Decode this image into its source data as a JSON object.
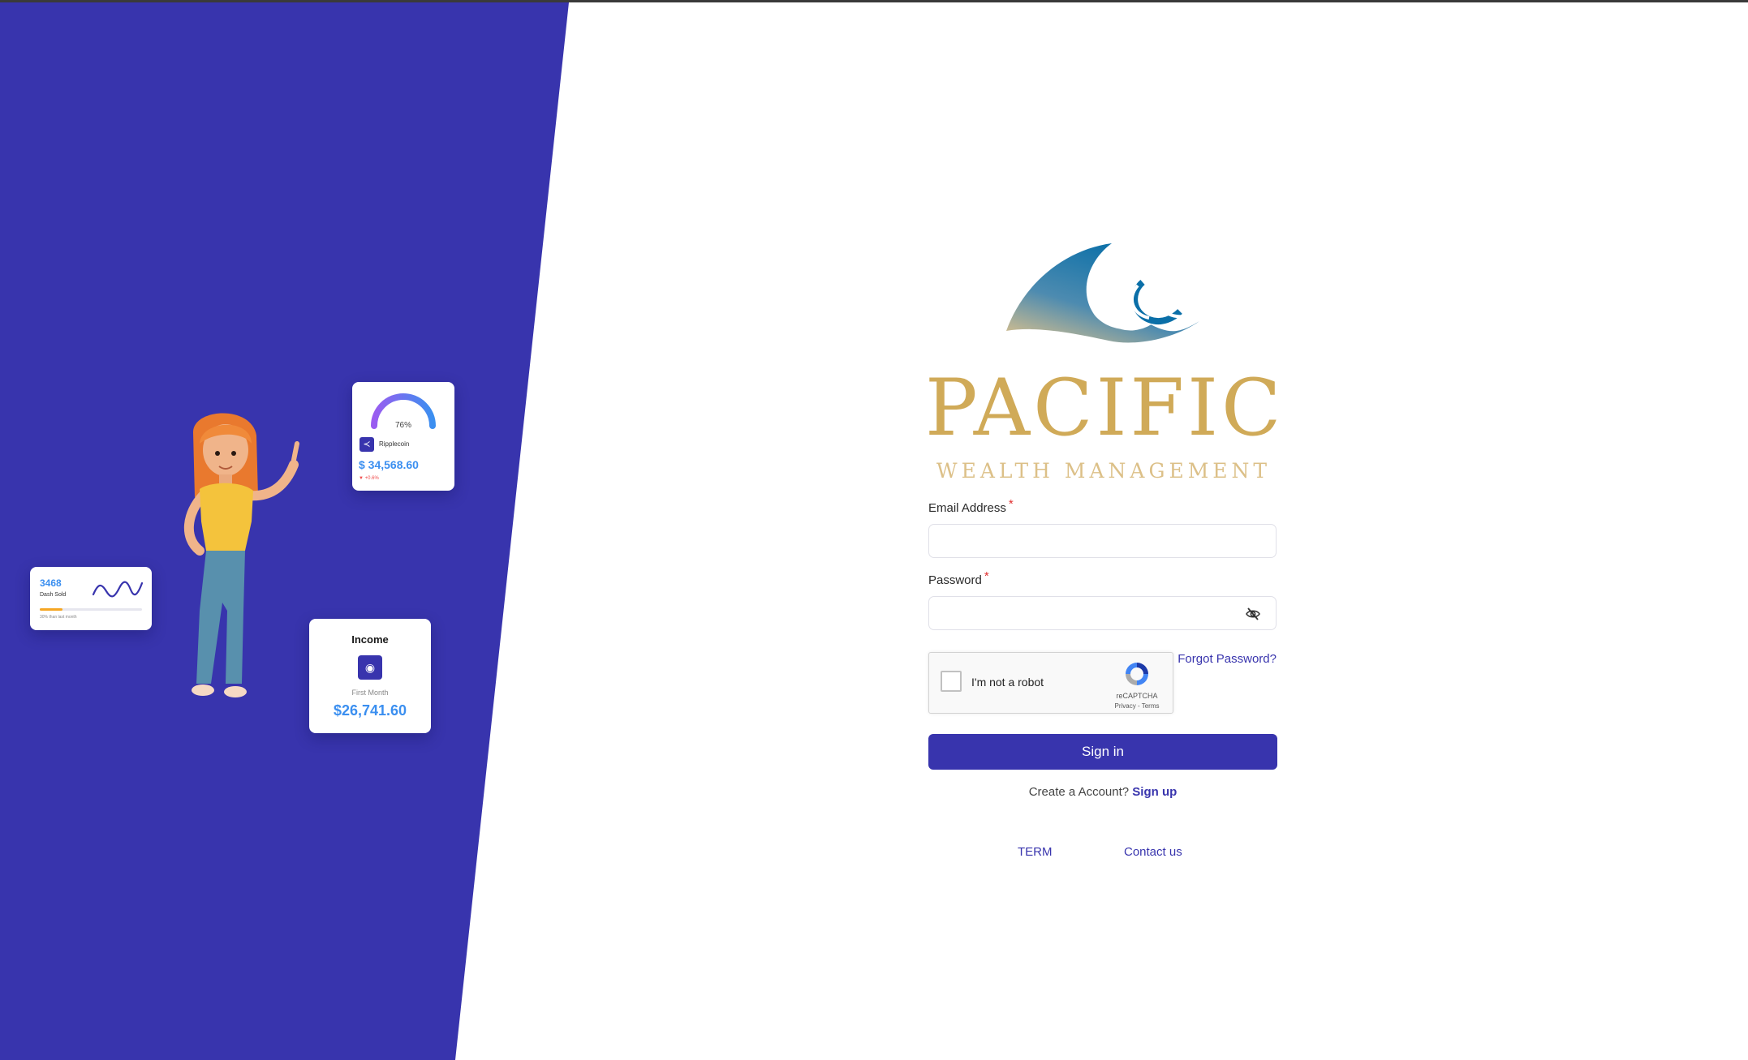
{
  "hero": {
    "ripple_card": {
      "gauge_percent": "76%",
      "gauge_value": 0.76,
      "coin_name": "Ripplecoin",
      "price": "$ 34,568.60",
      "change": "▼ +0.6%"
    },
    "dash_card": {
      "number": "3468",
      "label": "Dash Sold",
      "progress": 0.22,
      "note": "30% than last month"
    },
    "income_card": {
      "title": "Income",
      "subtitle": "First Month",
      "value": "$26,741.60"
    }
  },
  "brand": {
    "name": "PACIFIC",
    "tagline": "WEALTH MANAGEMENT"
  },
  "form": {
    "email_label": "Email Address",
    "email_value": "",
    "password_label": "Password",
    "password_value": "",
    "required_marker": "*",
    "captcha_label": "I'm not a robot",
    "captcha_brand": "reCAPTCHA",
    "captcha_links": "Privacy - Terms",
    "forgot_password": "Forgot Password?",
    "signin_label": "Sign in",
    "create_prompt": "Create a Account?",
    "signup_link": "Sign up"
  },
  "footer": {
    "term": "TERM",
    "contact": "Contact us"
  },
  "colors": {
    "primary": "#3834ad",
    "gold": "#d0aa58",
    "accent_blue": "#3b8ff0"
  },
  "icons": {
    "password_toggle": "eye-slash-icon",
    "coin": "ripple-icon",
    "income": "wallet-icon"
  }
}
